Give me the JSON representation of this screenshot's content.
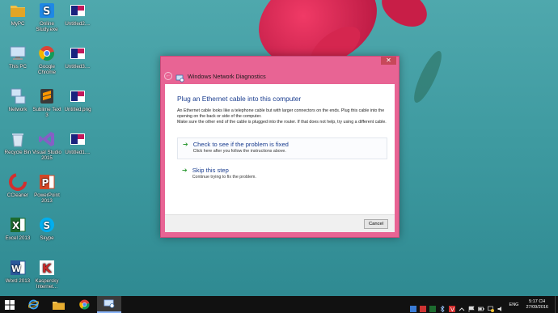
{
  "desktop_icons": [
    {
      "label": "MyPC",
      "icon": "folder-icon"
    },
    {
      "label": "Online Study.exe",
      "icon": "app-icon"
    },
    {
      "label": "Untitled2....",
      "icon": "image-icon"
    },
    {
      "label": "This PC",
      "icon": "computer-icon"
    },
    {
      "label": "Google Chrome",
      "icon": "chrome-icon"
    },
    {
      "label": "Untitled3....",
      "icon": "image-icon"
    },
    {
      "label": "Network",
      "icon": "network-icon"
    },
    {
      "label": "Sublime Text 3",
      "icon": "sublime-icon"
    },
    {
      "label": "Untitled.png",
      "icon": "image-icon"
    },
    {
      "label": "Recycle Bin",
      "icon": "recycle-bin-icon"
    },
    {
      "label": "Visual Studio 2015",
      "icon": "visual-studio-icon"
    },
    {
      "label": "Untitled1....",
      "icon": "image-icon"
    },
    {
      "label": "CCleaner",
      "icon": "ccleaner-icon"
    },
    {
      "label": "PowerPoint 2013",
      "icon": "powerpoint-icon"
    },
    {
      "label": "Excel 2013",
      "icon": "excel-icon"
    },
    {
      "label": "Skype",
      "icon": "skype-icon"
    },
    {
      "label": "Word 2013",
      "icon": "word-icon"
    },
    {
      "label": "Kaspersky Internet...",
      "icon": "kaspersky-icon"
    }
  ],
  "dialog": {
    "window_title": "Windows Network Diagnostics",
    "close_label": "✕",
    "back_label": "←",
    "heading": "Plug an Ethernet cable into this computer",
    "description": "An Ethernet cable looks like a telephone cable but with larger connectors on the ends. Plug this cable into the opening on the back or side of the computer.\nMake sure the other end of the cable is plugged into the router. If that does not help, try using a different cable.",
    "option1_title": "Check to see if the problem is fixed",
    "option1_sub": "Click here after you follow the instructions above.",
    "option2_title": "Skip this step",
    "option2_sub": "Continue trying to fix the problem.",
    "arrow": "➔",
    "cancel_label": "Cancel"
  },
  "taskbar": {
    "apps": [
      "start-icon",
      "ie-icon",
      "file-explorer-icon",
      "chrome-icon",
      "network-diagnostics-icon"
    ],
    "language": "ENG",
    "time": "5:17 CH",
    "date": "27/09/2016"
  },
  "colors": {
    "dialog_frame": "#e86494",
    "heading": "#1a3d8f",
    "arrow": "#2e9a35"
  }
}
